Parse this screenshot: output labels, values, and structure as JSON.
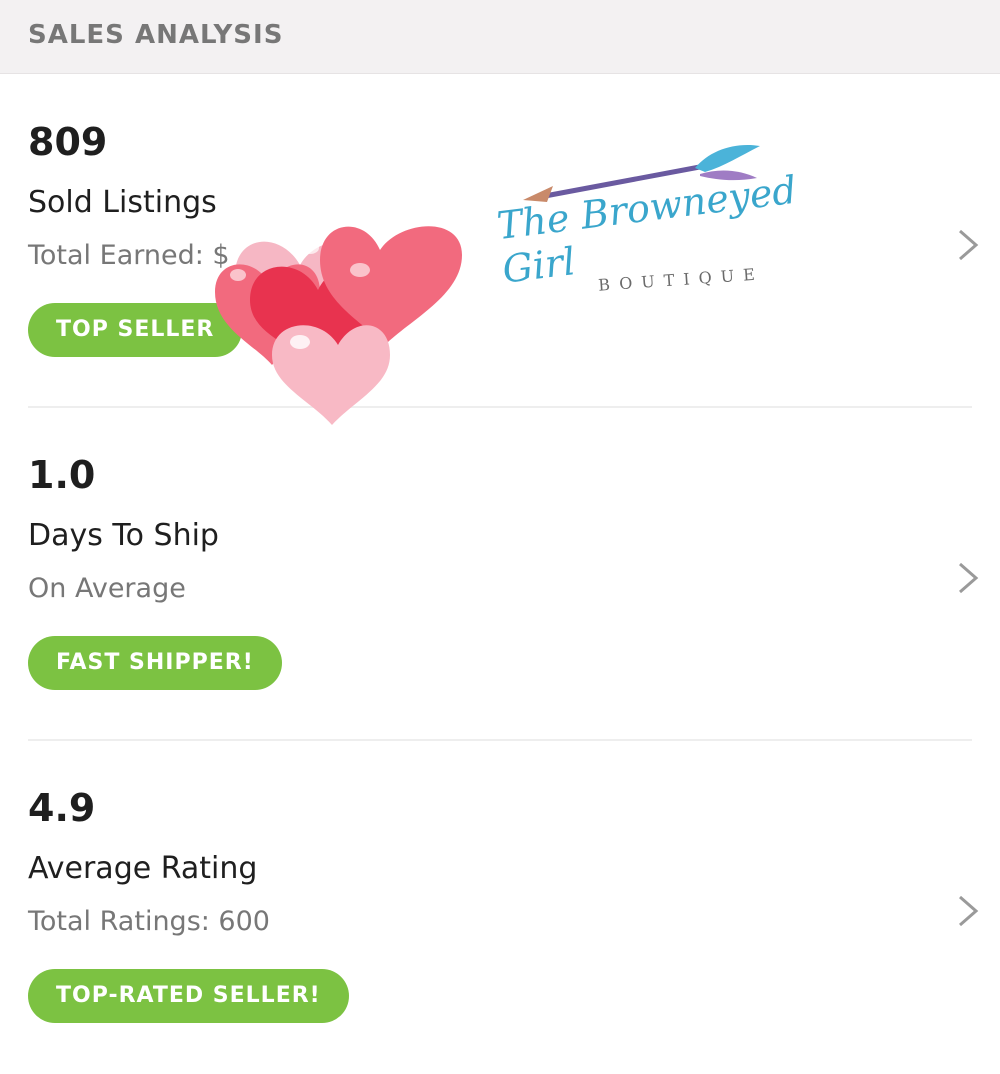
{
  "header": {
    "title": "SALES ANALYSIS"
  },
  "metrics": [
    {
      "value": "809",
      "label": "Sold Listings",
      "sub": "Total Earned: $",
      "badge": "TOP SELLER"
    },
    {
      "value": "1.0",
      "label": "Days To Ship",
      "sub": "On Average",
      "badge": "FAST SHIPPER!"
    },
    {
      "value": "4.9",
      "label": "Average Rating",
      "sub": "Total Ratings: 600",
      "badge": "TOP-RATED SELLER!"
    }
  ],
  "overlay": {
    "logo_text": "The Browneyed Girl",
    "logo_sub": "BOUTIQUE",
    "decoration": "hearts-balloons"
  },
  "colors": {
    "badge": "#7cc242",
    "header_bg": "#f3f1f2",
    "logo": "#3aa6cc",
    "hearts": [
      "#f26a7e",
      "#e8334f",
      "#f8b9c5"
    ]
  },
  "icons": {
    "row_arrow": "chevron-right-icon"
  }
}
